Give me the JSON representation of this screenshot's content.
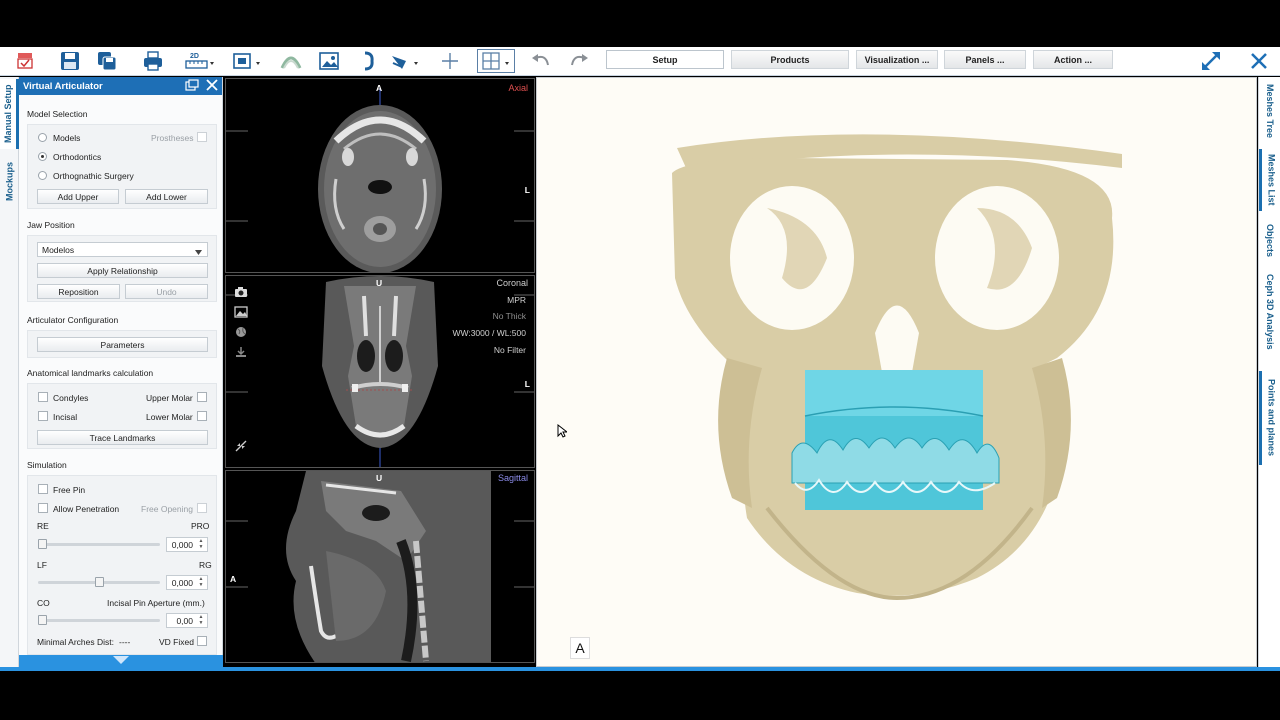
{
  "toolbar": {
    "icons": [
      "articulator-icon",
      "save-icon",
      "save-as-icon",
      "print-icon",
      "2d-ruler-icon",
      "crop-frame-icon",
      "arch-icon",
      "image-icon",
      "bracket-icon",
      "measure-icon",
      "crosshair-icon",
      "grid-layout-icon",
      "undo-icon",
      "redo-icon"
    ],
    "menu": {
      "setup": "Setup",
      "products": "Products",
      "visualization": "Visualization ...",
      "panels": "Panels ...",
      "action": "Action ..."
    },
    "tool_2d_label": "2D"
  },
  "left_tabs": {
    "manual_setup": "Manual Setup",
    "mockups": "Mockups"
  },
  "panel": {
    "title": "Virtual Articulator",
    "model_selection": {
      "title": "Model Selection",
      "models": "Models",
      "prostheses": "Prostheses",
      "orthodontics": "Orthodontics",
      "orthognathic": "Orthognathic Surgery",
      "add_upper": "Add Upper",
      "add_lower": "Add Lower"
    },
    "jaw_position": {
      "title": "Jaw Position",
      "selected": "Modelos",
      "apply": "Apply Relationship",
      "reposition": "Reposition",
      "undo": "Undo"
    },
    "articulator_config": {
      "title": "Articulator Configuration",
      "parameters": "Parameters"
    },
    "landmarks": {
      "title": "Anatomical landmarks calculation",
      "condyles": "Condyles",
      "upper_molar": "Upper Molar",
      "incisal": "Incisal",
      "lower_molar": "Lower Molar",
      "trace": "Trace Landmarks"
    },
    "simulation": {
      "title": "Simulation",
      "free_pin": "Free Pin",
      "allow_penetration": "Allow Penetration",
      "free_opening": "Free Opening",
      "re": "RE",
      "pro": "PRO",
      "re_value": "0,000",
      "re_fraction": 0.0,
      "lf": "LF",
      "rg": "RG",
      "lf_value": "0,000",
      "lf_fraction": 0.5,
      "co": "CO",
      "incisal_pin": "Incisal Pin Aperture (mm.)",
      "co_value": "0,00",
      "co_fraction": 0.0,
      "minimal_arches": "Minimal Arches Dist:",
      "minimal_arches_value": "----",
      "vd_fixed": "VD Fixed"
    }
  },
  "slices": {
    "axial": {
      "label": "Axial",
      "top": "A",
      "right": "L",
      "label_color": "#e05050"
    },
    "coronal": {
      "label": "Coronal",
      "top": "U",
      "right": "L",
      "overlay": [
        "MPR",
        "No Thick",
        "WW:3000 / WL:500",
        "No Filter"
      ],
      "icons": [
        "camera-icon",
        "image-icon",
        "globe-icon",
        "download-icon",
        "collapse-icon"
      ]
    },
    "sagittal": {
      "label": "Sagittal",
      "top": "U",
      "left": "A",
      "label_color": "#8a8ae6"
    }
  },
  "viewer3d": {
    "view_letter": "A",
    "bone_color": "#d9cda6",
    "splint_color": "#4fc6d9"
  },
  "right_tabs": {
    "meshes_tree": "Meshes Tree",
    "meshes_list": "Meshes List",
    "objects": "Objects",
    "ceph": "Ceph 3D Analysis",
    "points": "Points and planes"
  }
}
